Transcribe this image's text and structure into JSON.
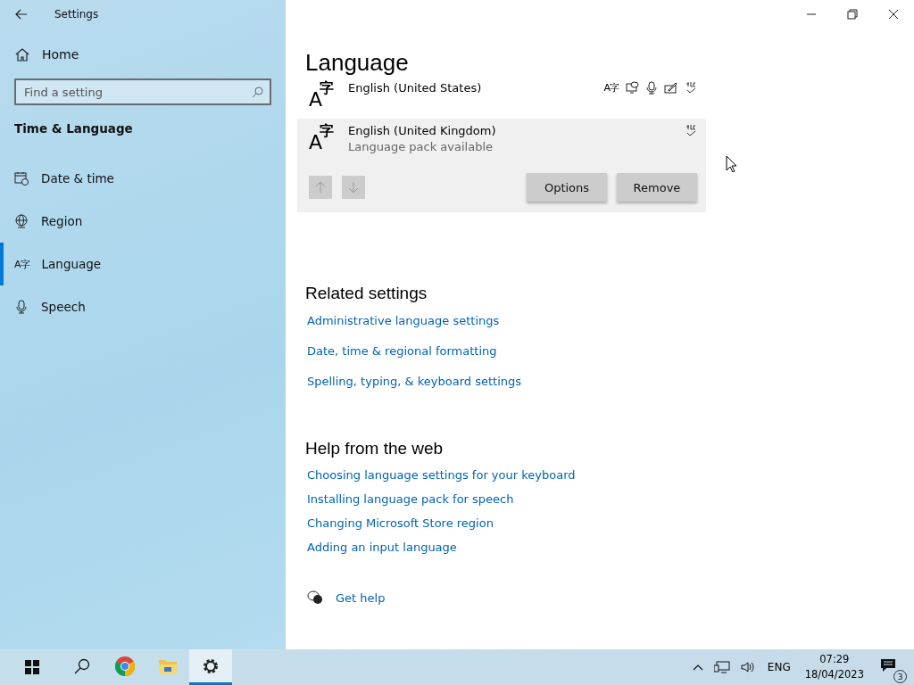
{
  "window": {
    "title": "Settings"
  },
  "sidebar": {
    "home": "Home",
    "search": {
      "placeholder": "Find a setting"
    },
    "section": "Time & Language",
    "items": [
      {
        "label": "Date & time",
        "kind": "calendar",
        "selected": false
      },
      {
        "label": "Region",
        "kind": "globe",
        "selected": false
      },
      {
        "label": "Language",
        "kind": "language",
        "glyph": "A字",
        "selected": true
      },
      {
        "label": "Speech",
        "kind": "mic",
        "selected": false
      }
    ]
  },
  "page_title": "Language",
  "languages": [
    {
      "name": "English (United States)",
      "icon_letter": "A",
      "icon_char": "字",
      "features": [
        {
          "kind": "language",
          "glyph": "A字"
        },
        {
          "kind": "speech-bubble"
        },
        {
          "kind": "mic"
        },
        {
          "kind": "pen"
        },
        {
          "kind": "spell"
        }
      ],
      "selected": false
    },
    {
      "name": "English (United Kingdom)",
      "icon_letter": "A",
      "icon_char": "字",
      "status": "Language pack available",
      "features": [
        {
          "kind": "spell"
        }
      ],
      "selected": true,
      "actions": [
        "Options",
        "Remove"
      ]
    }
  ],
  "related": {
    "title": "Related settings",
    "links": [
      "Administrative language settings",
      "Date, time & regional formatting",
      "Spelling, typing, & keyboard settings"
    ]
  },
  "help": {
    "title": "Help from the web",
    "links": [
      "Choosing language settings for your keyboard",
      "Installing language pack for speech",
      "Changing Microsoft Store region",
      "Adding an input language"
    ],
    "get_help": "Get help"
  },
  "taskbar": {
    "apps": [
      {
        "kind": "search",
        "selected": false
      },
      {
        "kind": "browser",
        "selected": false
      },
      {
        "kind": "folder",
        "selected": false
      },
      {
        "kind": "settings",
        "selected": true
      }
    ],
    "language": "ENG",
    "time": "07:29",
    "date": "18/04/2023",
    "notifications": "3"
  }
}
